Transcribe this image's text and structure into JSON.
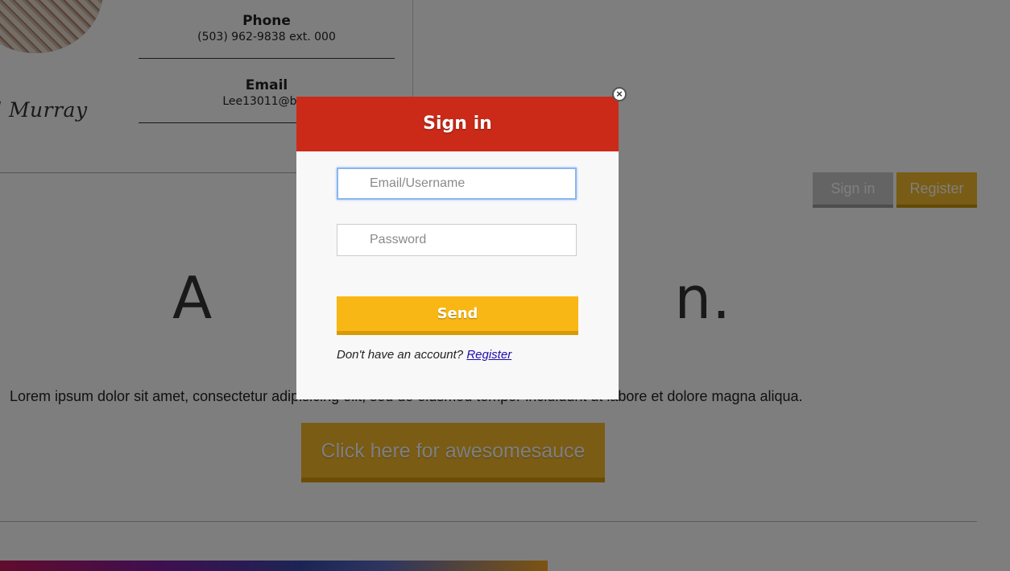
{
  "profile": {
    "name_fragment": "l Murray",
    "phone_label": "Phone",
    "phone_value": "(503) 962-9838 ext. 000",
    "email_label": "Email",
    "email_value": "Lee13011@byu"
  },
  "header_buttons": {
    "signin_label": "Sign in",
    "register_label": "Register"
  },
  "main": {
    "headline_visible": "A                        n.",
    "body_text": "Lorem ipsum dolor sit amet, consectetur adipisicing elit, sed do eiusmod tempor incididunt ut labore et dolore magna aliqua.",
    "cta_label": "Click here for awesomesauce"
  },
  "modal": {
    "title": "Sign in",
    "close_glyph": "×",
    "email_placeholder": "Email/Username",
    "password_placeholder": "Password",
    "send_label": "Send",
    "signup_prompt": "Don't have an account?",
    "signup_link": "Register"
  },
  "colors": {
    "modal_header": "#cc2a18",
    "accent_yellow": "#f8b714",
    "overlay": "rgba(0,0,0,0.5)"
  }
}
